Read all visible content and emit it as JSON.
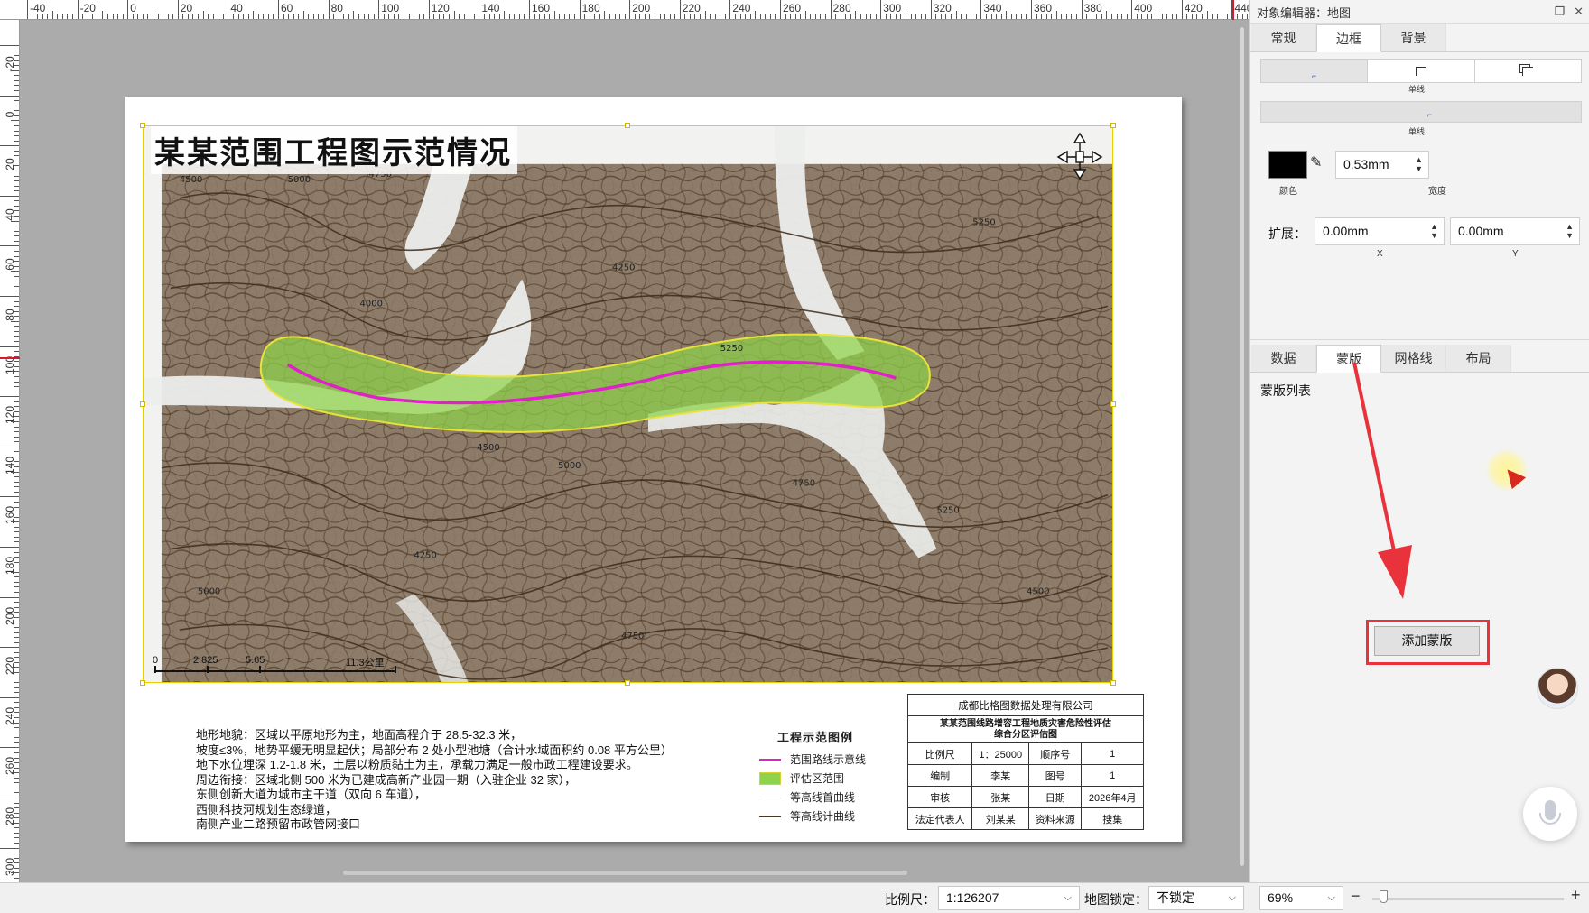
{
  "window": {
    "panel_title": "对象编辑器：地图"
  },
  "ruler": {
    "top_labels": [
      "-40",
      "-20",
      "0",
      "20",
      "40",
      "60",
      "80",
      "100",
      "120",
      "140",
      "160",
      "180",
      "200",
      "220",
      "240",
      "260",
      "280",
      "300",
      "320",
      "340",
      "360",
      "380",
      "400",
      "420",
      "440"
    ],
    "left_labels": [
      "-20",
      "0",
      "20",
      "40",
      "60",
      "80",
      "100",
      "120",
      "140",
      "160",
      "180",
      "200",
      "220",
      "240",
      "260",
      "280",
      "300"
    ]
  },
  "map": {
    "title": "某某范围工程图示范情况",
    "scalebar_labels": [
      "0",
      "2.825",
      "5.65",
      "11.3公里"
    ],
    "contour_labels": [
      "4500",
      "4750",
      "5000",
      "5250",
      "4250",
      "4000"
    ],
    "colors": {
      "route": "#e020c8",
      "area_fill": "#8fd34a",
      "area_border": "#e8e23a",
      "index_contour": "#4a3621",
      "terrain_dark": "#6b5a4a",
      "terrain_light": "#eef0ee"
    },
    "notes": [
      "地形地貌：区域以平原地形为主，地面高程介于 28.5-32.3 米，",
      "坡度≤3%，地势平缓无明显起伏；局部分布 2 处小型池塘（合计水域面积约 0.08 平方公里）",
      "地下水位埋深 1.2-1.8 米，土层以粉质黏土为主，承载力满足一般市政工程建设要求。",
      "周边衔接：区域北侧 500 米为已建成高新产业园一期（入驻企业 32 家），",
      "东侧创新大道为城市主干道（双向 6 车道），",
      "西侧科技河规划生态绿道，",
      "南侧产业二路预留市政管网接口"
    ],
    "legend": {
      "title": "工程示范图例",
      "items": [
        {
          "label": "范围路线示意线",
          "kind": "line",
          "color": "#e020c8"
        },
        {
          "label": "评估区范围",
          "kind": "fill",
          "color": "#8fd34a"
        },
        {
          "label": "等高线首曲线",
          "kind": "thin",
          "color": "#d9d9d9"
        },
        {
          "label": "等高线计曲线",
          "kind": "line",
          "color": "#4a3621"
        }
      ]
    },
    "info_table": {
      "company": "成都比格图数据处理有限公司",
      "subtitle_1": "某某范围线路增容工程地质灾害危险性评估",
      "subtitle_2": "综合分区评估图",
      "rows": [
        [
          "比例尺",
          "1：25000",
          "顺序号",
          "1"
        ],
        [
          "编制",
          "李某",
          "图号",
          "1"
        ],
        [
          "审核",
          "张某",
          "日期",
          "2026年4月"
        ],
        [
          "法定代表人",
          "刘某某",
          "资料来源",
          "搜集"
        ]
      ]
    }
  },
  "panel": {
    "top_tabs": [
      "常规",
      "边框",
      "背景"
    ],
    "top_active": 1,
    "border_styles": [
      "",
      "单线",
      ""
    ],
    "border_line_label": "单线",
    "color_label": "颜色",
    "color_value": "#000000",
    "width_value": "0.53mm",
    "width_label": "宽度",
    "expand_label": "扩展：",
    "expand_x": "0.00mm",
    "expand_y": "0.00mm",
    "x_label": "X",
    "y_label": "Y",
    "lower_tabs": [
      "数据",
      "蒙版",
      "网格线",
      "布局"
    ],
    "lower_active": 1,
    "mask_list_label": "蒙版列表",
    "add_mask_button": "添加蒙版"
  },
  "statusbar": {
    "scale_label": "比例尺：",
    "scale_value": "1:126207",
    "lock_label": "地图锁定：",
    "lock_value": "不锁定",
    "zoom_value": "69%",
    "zoom_level": 0.04
  }
}
